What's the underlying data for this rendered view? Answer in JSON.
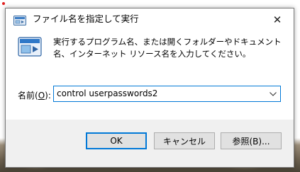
{
  "window": {
    "title": "ファイル名を指定して実行",
    "close_glyph": "✕"
  },
  "dialog": {
    "message": "実行するプログラム名、または開くフォルダーやドキュメント名、インターネット リソース名を入力してください。",
    "name_label_prefix": "名前(",
    "name_label_mnemonic": "O",
    "name_label_suffix": "):",
    "input_value": "control userpasswords2"
  },
  "buttons": {
    "ok": "OK",
    "cancel": "キャンセル",
    "browse": "参照(B)..."
  },
  "icons": {
    "title_icon": "run-app-icon",
    "main_icon": "run-app-icon",
    "dropdown": "chevron-down-icon",
    "close": "close-icon"
  },
  "colors": {
    "accent": "#0078d7",
    "dialog_bg": "#f0f0f0",
    "content_bg": "#ffffff",
    "button_bg": "#e1e1e1"
  }
}
